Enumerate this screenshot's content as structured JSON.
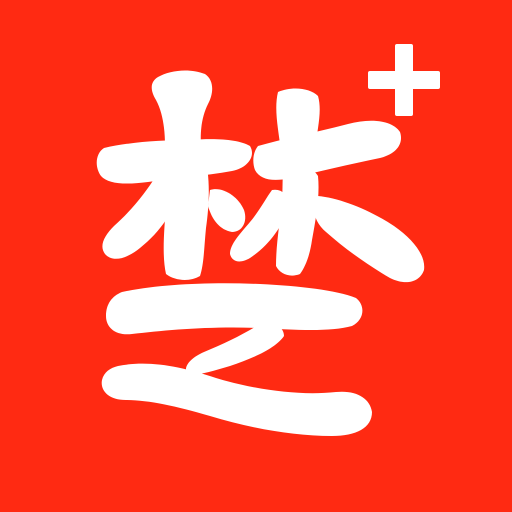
{
  "logo": {
    "glyph": "楚",
    "badge_symbol": "+",
    "background_color": "#ff2a12",
    "foreground_color": "#ffffff",
    "icon_name": "chu-plus-logo-icon"
  }
}
